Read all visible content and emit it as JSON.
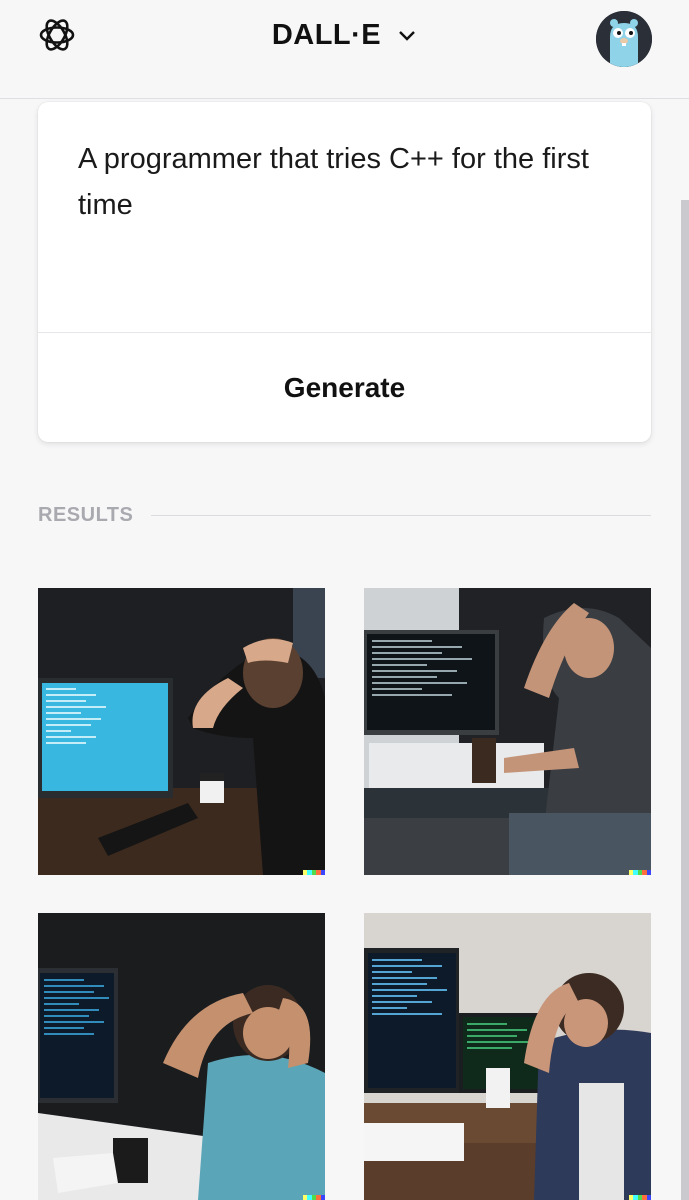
{
  "header": {
    "app_title": "DALL·E",
    "logo_icon": "openai-logo-icon",
    "dropdown_icon": "chevron-down-icon",
    "avatar_icon": "gopher-avatar-icon"
  },
  "prompt": {
    "text": "A programmer that tries C++ for the first time",
    "generate_label": "Generate"
  },
  "results": {
    "label": "RESULTS",
    "images": [
      {
        "icon": "generated-image-1"
      },
      {
        "icon": "generated-image-2"
      },
      {
        "icon": "generated-image-3"
      },
      {
        "icon": "generated-image-4"
      }
    ]
  },
  "colors": {
    "background": "#f7f7f8",
    "card": "#ffffff",
    "results_label": "#a9a9b0",
    "watermark": [
      "#ffff66",
      "#42ffff",
      "#51da4c",
      "#ff6e3c",
      "#3c46ff"
    ]
  }
}
